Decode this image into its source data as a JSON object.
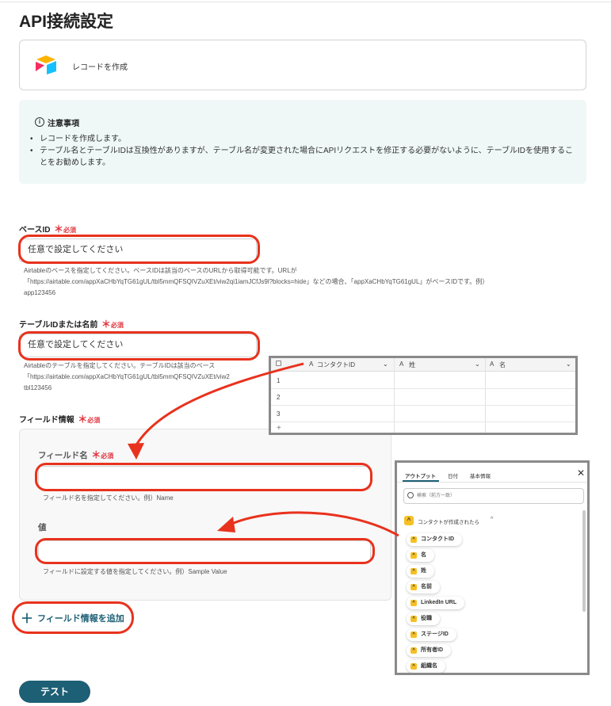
{
  "page": {
    "title": "API接続設定"
  },
  "action": {
    "label": "レコードを作成",
    "icon": "airtable-logo-icon"
  },
  "notice": {
    "title": "注意事項",
    "items": [
      "レコードを作成します。",
      "テーブル名とテーブルIDは互換性がありますが、テーブル名が変更された場合にAPIリクエストを修正する必要がないように、テーブルIDを使用することをお勧めします。"
    ]
  },
  "required_label": "必須",
  "base_id": {
    "label": "ベースID",
    "placeholder": "任意で設定してください",
    "help_1": "Airtableのベースを指定してください。ベースIDは該当のベースのURLから取得可能です。URLが",
    "help_2": "「https://airtable.com/appXaCHbYqTG61gUL/tbl5mmQFSQIVZuXEt/viw2qi1iamJCfJs9l?blocks=hide」などの場合、「appXaCHbYqTG61gUL」がベースIDです。例）",
    "help_3": "app123456"
  },
  "table_id": {
    "label": "テーブルIDまたは名前",
    "placeholder": "任意で設定してください",
    "help_1": "Airtableのテーブルを指定してください。テーブルIDは該当のベース",
    "help_2": "「https://airtable.com/appXaCHbYqTG61gUL/tbl5mmQFSQIVZuXEt/viw2",
    "help_3": "tbl123456"
  },
  "field_info": {
    "label": "フィールド情報",
    "field_name_label": "フィールド名",
    "field_name_value": "",
    "field_name_help": "フィールド名を指定してください。例）Name",
    "value_label": "値",
    "value_value": "",
    "value_help": "フィールドに設定する値を指定してください。例）Sample Value",
    "add_label": "フィールド情報を追加"
  },
  "test_button": "テスト",
  "table_overlay": {
    "columns": [
      "コンタクトID",
      "姓",
      "名"
    ],
    "rows": [
      "1",
      "2",
      "3"
    ],
    "add": "+"
  },
  "picker": {
    "tabs": [
      "アウトプット",
      "日付",
      "基本情報"
    ],
    "close": "✕",
    "search_placeholder": "検索（前方一致）",
    "group": "コンタクトが作成されたら",
    "group_chevron": "^",
    "items": [
      "コンタクトID",
      "名",
      "姓",
      "名前",
      "LinkedIn URL",
      "役職",
      "ステージID",
      "所有者ID",
      "組織名"
    ]
  },
  "colors": {
    "accent": "#1d5f75",
    "highlight": "#e8321d",
    "required": "#e0323c",
    "notice_bg": "#eff8f6"
  }
}
